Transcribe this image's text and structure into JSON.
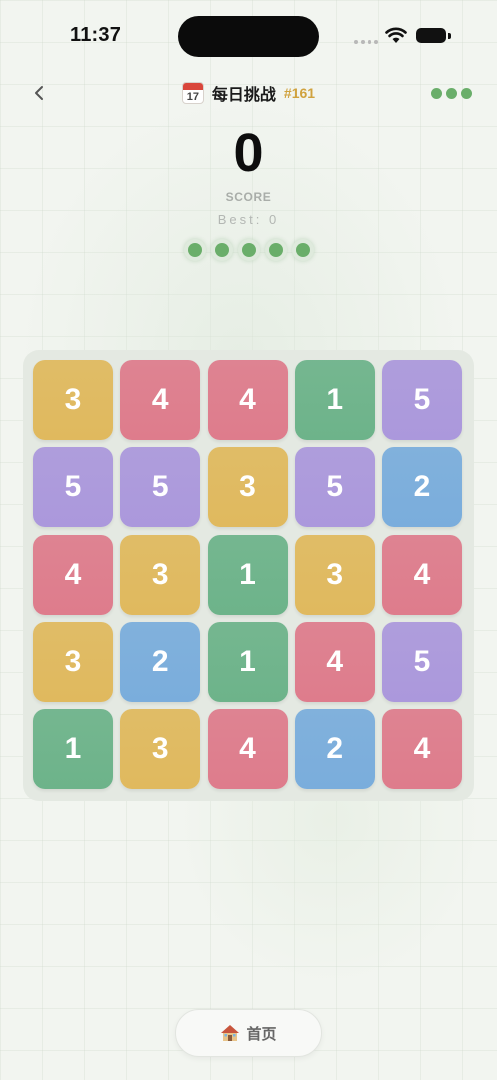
{
  "status_bar": {
    "time": "11:37"
  },
  "header": {
    "title": "每日挑战",
    "challenge_number": "#161",
    "calendar_day": "17",
    "icons": {
      "back": "chevron-left-icon",
      "calendar": "calendar-icon",
      "menu": "more-dots-icon"
    }
  },
  "score": {
    "value": "0",
    "label": "SCORE",
    "best": "Best: 0"
  },
  "lives": {
    "count": 5,
    "remaining": 5,
    "color": "#6aae6a"
  },
  "tile_colors": {
    "1": "#6db38a",
    "2": "#7aaddc",
    "3": "#e0b95e",
    "4": "#de7c8c",
    "5": "#ab98dc"
  },
  "board": {
    "rows": [
      [
        "3",
        "4",
        "4",
        "1",
        "5"
      ],
      [
        "5",
        "5",
        "3",
        "5",
        "2"
      ],
      [
        "4",
        "3",
        "1",
        "3",
        "4"
      ],
      [
        "3",
        "2",
        "1",
        "4",
        "5"
      ],
      [
        "1",
        "3",
        "4",
        "2",
        "4"
      ]
    ]
  },
  "footer": {
    "home_label": "首页",
    "home_icon": "house-icon"
  }
}
